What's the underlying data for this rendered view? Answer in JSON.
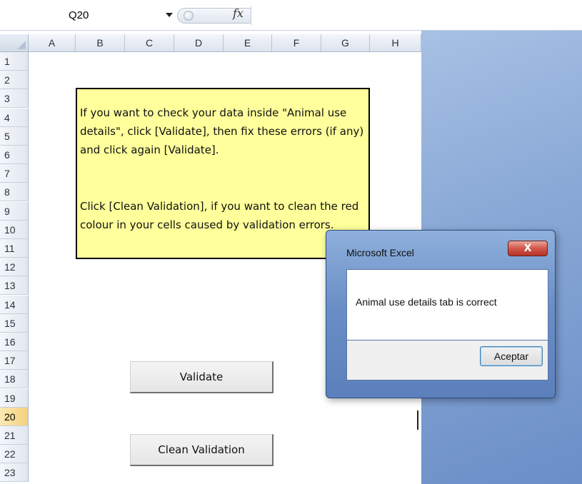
{
  "formula_bar": {
    "name_box": "Q20",
    "fx_label": "fx",
    "formula_value": ""
  },
  "columns": [
    "A",
    "B",
    "C",
    "D",
    "E",
    "F",
    "G",
    "H"
  ],
  "rows": [
    "1",
    "2",
    "3",
    "4",
    "5",
    "6",
    "7",
    "8",
    "9",
    "10",
    "11",
    "12",
    "13",
    "14",
    "15",
    "16",
    "17",
    "18",
    "19",
    "20",
    "21",
    "22",
    "23"
  ],
  "active_row": "20",
  "note": {
    "paragraph1": "If you want to check your data inside \"Animal use details\", click [Validate], then fix these errors (if any) and click again [Validate].",
    "paragraph2": "Click [Clean Validation], if you want to clean the red colour in your cells caused by validation errors."
  },
  "buttons": {
    "validate": "Validate",
    "clean_validation": "Clean Validation"
  },
  "dialog": {
    "title": "Microsoft Excel",
    "close_glyph": "X",
    "message": "Animal use details tab is correct",
    "accept_label": "Aceptar"
  }
}
